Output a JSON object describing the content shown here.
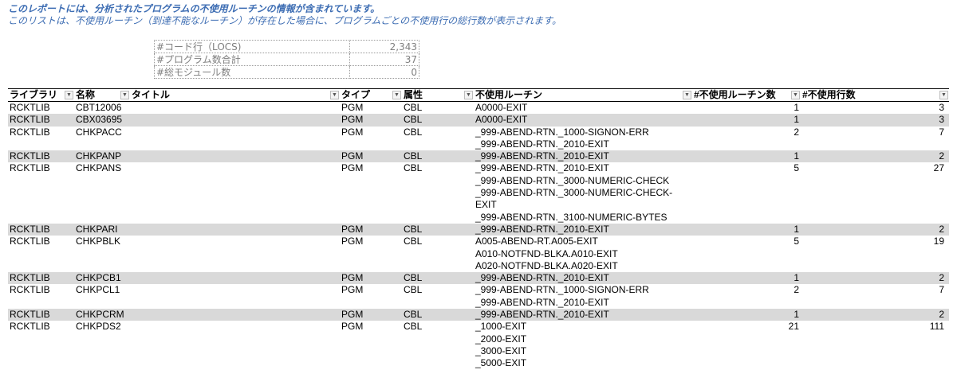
{
  "notes": {
    "line1": "このレポートには、分析されたプログラムの不使用ルーチンの情報が含まれています。",
    "line2": "このリストは、不使用ルーチン（到達不能なルーチン）が存在した場合に、プログラムごとの不使用行の総行数が表示されます。"
  },
  "summary": [
    {
      "label": "#コード行（LOCS)",
      "value": "2,343"
    },
    {
      "label": "#プログラム数合計",
      "value": "37"
    },
    {
      "label": "#総モジュール数",
      "value": "0"
    }
  ],
  "filter_icon": "dropdown-filter-icon",
  "columns": [
    "ライブラリ",
    "名称",
    "タイトル",
    "タイプ",
    "属性",
    "不使用ルーチン",
    "#不使用ルーチン数",
    "#不使用行数"
  ],
  "rows": [
    {
      "library": "RCKTLIB",
      "name": "CBT12006",
      "title": "",
      "type": "PGM",
      "attr": "CBL",
      "routines": [
        "A0000-EXIT"
      ],
      "routine_count": "1",
      "line_count": "3"
    },
    {
      "library": "RCKTLIB",
      "name": "CBX03695",
      "title": "",
      "type": "PGM",
      "attr": "CBL",
      "routines": [
        "A0000-EXIT"
      ],
      "routine_count": "1",
      "line_count": "3"
    },
    {
      "library": "RCKTLIB",
      "name": "CHKPACC",
      "title": "",
      "type": "PGM",
      "attr": "CBL",
      "routines": [
        "_999-ABEND-RTN._1000-SIGNON-ERR",
        "_999-ABEND-RTN._2010-EXIT"
      ],
      "routine_count": "2",
      "line_count": "7"
    },
    {
      "library": "RCKTLIB",
      "name": "CHKPANP",
      "title": "",
      "type": "PGM",
      "attr": "CBL",
      "routines": [
        "_999-ABEND-RTN._2010-EXIT"
      ],
      "routine_count": "1",
      "line_count": "2"
    },
    {
      "library": "RCKTLIB",
      "name": "CHKPANS",
      "title": "",
      "type": "PGM",
      "attr": "CBL",
      "routines": [
        "_999-ABEND-RTN._2010-EXIT",
        "_999-ABEND-RTN._3000-NUMERIC-CHECK",
        "_999-ABEND-RTN._3000-NUMERIC-CHECK-",
        "EXIT",
        "_999-ABEND-RTN._3100-NUMERIC-BYTES"
      ],
      "routine_count": "5",
      "line_count": "27"
    },
    {
      "library": "RCKTLIB",
      "name": "CHKPARI",
      "title": "",
      "type": "PGM",
      "attr": "CBL",
      "routines": [
        "_999-ABEND-RTN._2010-EXIT"
      ],
      "routine_count": "1",
      "line_count": "2"
    },
    {
      "library": "RCKTLIB",
      "name": "CHKPBLK",
      "title": "",
      "type": "PGM",
      "attr": "CBL",
      "routines": [
        "A005-ABEND-RT.A005-EXIT",
        "A010-NOTFND-BLKA.A010-EXIT",
        "A020-NOTFND-BLKA.A020-EXIT"
      ],
      "routine_count": "5",
      "line_count": "19"
    },
    {
      "library": "RCKTLIB",
      "name": "CHKPCB1",
      "title": "",
      "type": "PGM",
      "attr": "CBL",
      "routines": [
        "_999-ABEND-RTN._2010-EXIT"
      ],
      "routine_count": "1",
      "line_count": "2"
    },
    {
      "library": "RCKTLIB",
      "name": "CHKPCL1",
      "title": "",
      "type": "PGM",
      "attr": "CBL",
      "routines": [
        "_999-ABEND-RTN._1000-SIGNON-ERR",
        "_999-ABEND-RTN._2010-EXIT"
      ],
      "routine_count": "2",
      "line_count": "7"
    },
    {
      "library": "RCKTLIB",
      "name": "CHKPCRM",
      "title": "",
      "type": "PGM",
      "attr": "CBL",
      "routines": [
        "_999-ABEND-RTN._2010-EXIT"
      ],
      "routine_count": "1",
      "line_count": "2"
    },
    {
      "library": "RCKTLIB",
      "name": "CHKPDS2",
      "title": "",
      "type": "PGM",
      "attr": "CBL",
      "routines": [
        "_1000-EXIT",
        "_2000-EXIT",
        "_3000-EXIT",
        "_5000-EXIT"
      ],
      "routine_count": "21",
      "line_count": "111"
    }
  ]
}
